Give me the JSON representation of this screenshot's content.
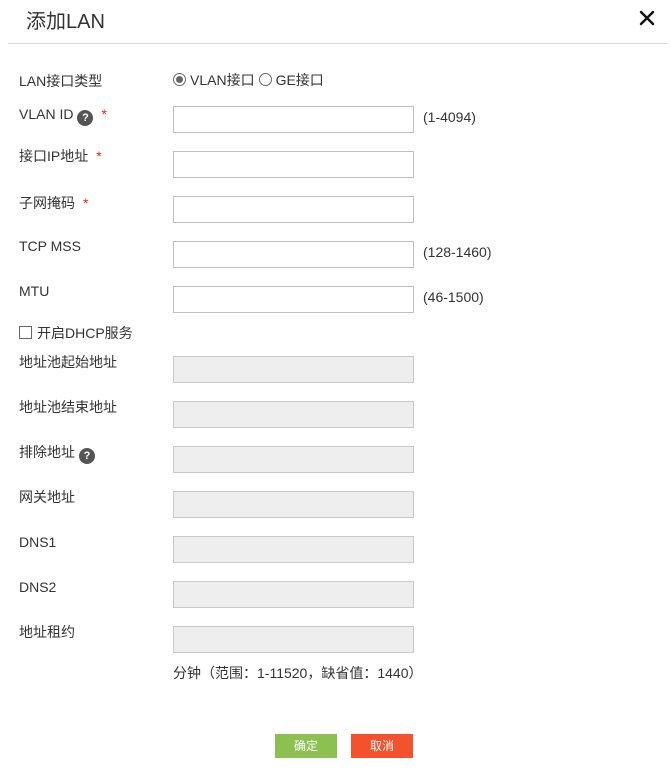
{
  "dialog": {
    "title": "添加LAN",
    "close_icon": "close-icon"
  },
  "form": {
    "lan_type": {
      "label": "LAN接口类型",
      "options": [
        {
          "label": "VLAN接口",
          "selected": true
        },
        {
          "label": "GE接口",
          "selected": false
        }
      ]
    },
    "vlan_id": {
      "label": "VLAN ID",
      "required": "*",
      "value": "",
      "hint": "(1-4094)",
      "help_icon": "question-icon"
    },
    "ip": {
      "label": "接口IP地址",
      "required": "*",
      "value": ""
    },
    "mask": {
      "label": "子网掩码",
      "required": "*",
      "value": ""
    },
    "tcp_mss": {
      "label": "TCP MSS",
      "value": "",
      "hint": "(128-1460)"
    },
    "mtu": {
      "label": "MTU",
      "value": "",
      "hint": "(46-1500)"
    },
    "dhcp": {
      "label": "开启DHCP服务",
      "checked": false
    },
    "pool_start": {
      "label": "地址池起始地址",
      "value": ""
    },
    "pool_end": {
      "label": "地址池结束地址",
      "value": ""
    },
    "exclude": {
      "label": "排除地址",
      "value": "",
      "help_icon": "question-icon"
    },
    "gateway": {
      "label": "网关地址",
      "value": ""
    },
    "dns1": {
      "label": "DNS1",
      "value": ""
    },
    "dns2": {
      "label": "DNS2",
      "value": ""
    },
    "lease": {
      "label": "地址租约",
      "value": "",
      "note": "分钟（范围：1-11520，缺省值：1440）"
    }
  },
  "buttons": {
    "ok": "确定",
    "cancel": "取消"
  },
  "colors": {
    "ok_button": "#8cc152",
    "cancel_button": "#f4522d",
    "required_mark": "#e0281e"
  }
}
